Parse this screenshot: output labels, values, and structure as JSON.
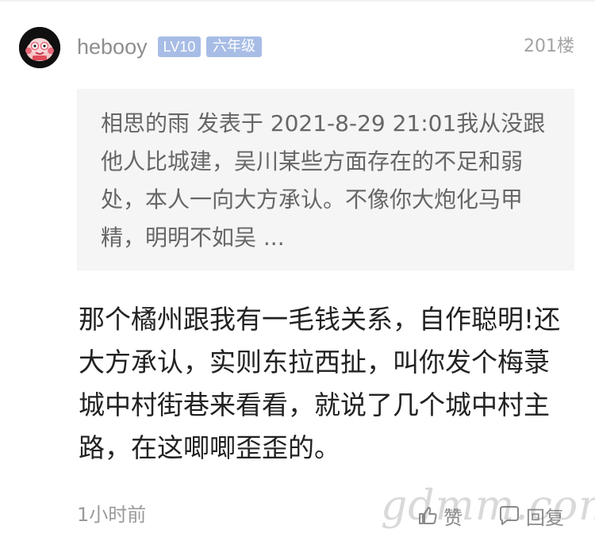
{
  "post": {
    "username": "hebooy",
    "level_badge": "LV10",
    "grade_badge": "六年级",
    "floor": "201楼",
    "quote": "相思的雨 发表于 2021-8-29 21:01我从没跟他人比城建，吴川某些方面存在的不足和弱处，本人一向大方承认。不像你大炮化马甲精，明明不如吴 ...",
    "content": "那个橘州跟我有一毛钱关系，自作聪明!还大方承认，实则东拉西扯，叫你发个梅菉城中村街巷来看看，就说了几个城中村主路，在这唧唧歪歪的。",
    "time": "1小时前",
    "like_label": "赞",
    "reply_label": "回复"
  },
  "watermark": "gdmm.com",
  "colors": {
    "badge_bg": "#a8bde6",
    "quote_bg": "#f5f5f5",
    "text": "#222222",
    "muted": "#9a9a9a"
  },
  "icons": {
    "avatar": "cartoon-avatar",
    "like": "thumbs-up-icon",
    "reply": "comment-icon"
  }
}
